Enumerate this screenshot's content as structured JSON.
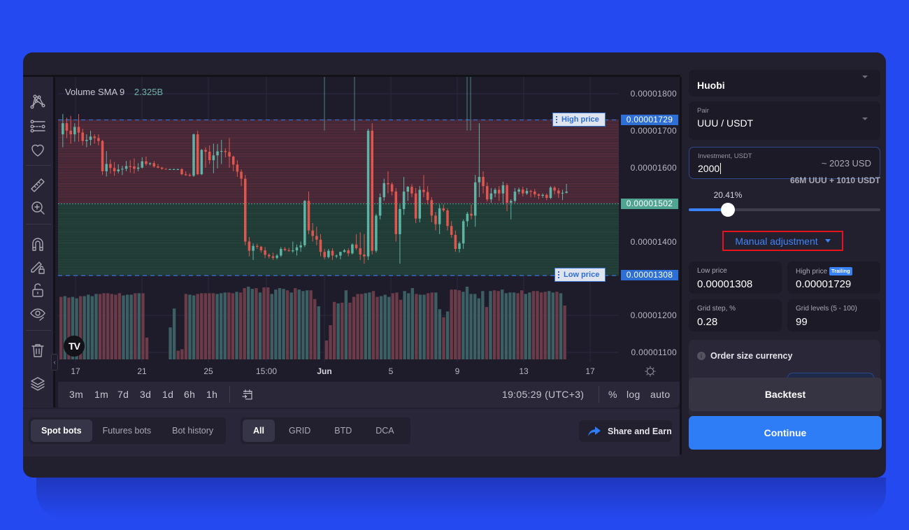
{
  "chart": {
    "volume_legend": {
      "label": "Volume SMA 9",
      "value": "2.325B"
    },
    "price_axis": {
      "labels": [
        "0.00001800",
        "0.00001700",
        "0.00001600",
        "0.00001400",
        "0.00001200",
        "0.00001100"
      ],
      "high_price_tag": "0.00001729",
      "current_price_tag": "0.00001502",
      "low_price_tag": "0.00001308"
    },
    "level_tags": {
      "high": "High price",
      "low": "Low price"
    },
    "time_axis": [
      "17",
      "21",
      "25",
      "15:00",
      "Jun",
      "5",
      "9",
      "13",
      "17"
    ],
    "range_buttons": [
      "3m",
      "1m",
      "7d",
      "3d",
      "1d",
      "6h",
      "1h"
    ],
    "clock": "19:05:29 (UTC+3)",
    "scale_buttons": [
      "%",
      "log",
      "auto"
    ],
    "logo": "TV",
    "colors": {
      "up": "#5fb3a5",
      "down": "#e0564f",
      "high_line": "#3a6fd8",
      "current_tag": "#4fa592",
      "level_tag": "#2e7cf6"
    },
    "candles": [
      [
        1690,
        1745,
        1655,
        1720
      ],
      [
        1720,
        1735,
        1680,
        1700
      ],
      [
        1700,
        1740,
        1665,
        1690
      ],
      [
        1690,
        1720,
        1670,
        1710
      ],
      [
        1710,
        1745,
        1670,
        1695
      ],
      [
        1695,
        1705,
        1660,
        1672
      ],
      [
        1672,
        1690,
        1655,
        1675
      ],
      [
        1675,
        1700,
        1660,
        1684
      ],
      [
        1684,
        1690,
        1665,
        1680
      ],
      [
        1680,
        1690,
        1660,
        1672
      ],
      [
        1672,
        1675,
        1580,
        1590
      ],
      [
        1590,
        1645,
        1576,
        1610
      ],
      [
        1610,
        1622,
        1584,
        1599
      ],
      [
        1599,
        1615,
        1578,
        1590
      ],
      [
        1590,
        1609,
        1585,
        1595
      ],
      [
        1595,
        1605,
        1580,
        1597
      ],
      [
        1597,
        1618,
        1590,
        1604
      ],
      [
        1604,
        1620,
        1586,
        1603
      ],
      [
        1603,
        1625,
        1584,
        1597
      ],
      [
        1597,
        1612,
        1590,
        1600
      ],
      [
        1600,
        1628,
        1598,
        1617
      ],
      [
        1617,
        1630,
        1605,
        1610
      ],
      [
        1610,
        1614,
        1606,
        1612
      ],
      [
        1612,
        1618,
        1600,
        1603
      ],
      [
        1603,
        1610,
        1598,
        1600
      ],
      [
        1600,
        1602,
        1594,
        1597
      ],
      [
        1597,
        1598,
        1595,
        1596
      ],
      [
        1596,
        1597,
        1595,
        1596
      ],
      [
        1596,
        1597,
        1595,
        1596
      ],
      [
        1596,
        1597,
        1595,
        1596
      ],
      [
        1596,
        1598,
        1580,
        1582
      ],
      [
        1582,
        1590,
        1578,
        1580
      ],
      [
        1580,
        1584,
        1576,
        1578
      ],
      [
        1578,
        1692,
        1575,
        1690
      ],
      [
        1690,
        1700,
        1580,
        1582
      ],
      [
        1582,
        1650,
        1580,
        1648
      ],
      [
        1648,
        1655,
        1600,
        1643
      ],
      [
        1643,
        1660,
        1610,
        1620
      ],
      [
        1620,
        1665,
        1585,
        1633
      ],
      [
        1633,
        1664,
        1598,
        1644
      ],
      [
        1644,
        1675,
        1610,
        1645
      ],
      [
        1645,
        1652,
        1628,
        1642
      ],
      [
        1642,
        1680,
        1600,
        1630
      ],
      [
        1630,
        1632,
        1590,
        1608
      ],
      [
        1608,
        1620,
        1575,
        1589
      ],
      [
        1589,
        1595,
        1550,
        1570
      ],
      [
        1570,
        1580,
        1390,
        1400
      ],
      [
        1400,
        1412,
        1360,
        1375
      ],
      [
        1375,
        1395,
        1350,
        1388
      ],
      [
        1388,
        1394,
        1380,
        1386
      ],
      [
        1386,
        1388,
        1370,
        1376
      ],
      [
        1376,
        1385,
        1355,
        1364
      ],
      [
        1364,
        1368,
        1354,
        1360
      ],
      [
        1360,
        1370,
        1350,
        1356
      ],
      [
        1356,
        1366,
        1352,
        1362
      ],
      [
        1362,
        1385,
        1358,
        1380
      ],
      [
        1380,
        1385,
        1374,
        1377
      ],
      [
        1377,
        1383,
        1372,
        1375
      ],
      [
        1375,
        1400,
        1370,
        1376
      ],
      [
        1376,
        1392,
        1362,
        1384
      ],
      [
        1384,
        1400,
        1372,
        1390
      ],
      [
        1390,
        1512,
        1385,
        1510
      ],
      [
        1510,
        1535,
        1420,
        1430
      ],
      [
        1430,
        1450,
        1400,
        1415
      ],
      [
        1415,
        1440,
        1390,
        1405
      ],
      [
        1405,
        1420,
        1360,
        1372
      ],
      [
        1372,
        1380,
        1352,
        1358
      ],
      [
        1358,
        1380,
        1354,
        1375
      ],
      [
        1375,
        1382,
        1350,
        1362
      ],
      [
        1362,
        1365,
        1355,
        1362
      ],
      [
        1362,
        1370,
        1352,
        1372
      ],
      [
        1372,
        1380,
        1370,
        1376
      ],
      [
        1376,
        1382,
        1360,
        1368
      ],
      [
        1368,
        1395,
        1365,
        1392
      ],
      [
        1392,
        1420,
        1378,
        1382
      ],
      [
        1382,
        1425,
        1350,
        1365
      ],
      [
        1365,
        1420,
        1340,
        1360
      ],
      [
        1360,
        1705,
        1350,
        1700
      ],
      [
        1700,
        1720,
        1365,
        1375
      ],
      [
        1375,
        1475,
        1370,
        1470
      ],
      [
        1470,
        1530,
        1460,
        1520
      ],
      [
        1520,
        1570,
        1510,
        1558
      ],
      [
        1558,
        1590,
        1530,
        1555
      ],
      [
        1555,
        1560,
        1525,
        1535
      ],
      [
        1535,
        1545,
        1400,
        1420
      ],
      [
        1420,
        1500,
        1340,
        1488
      ],
      [
        1488,
        1575,
        1472,
        1535
      ],
      [
        1535,
        1550,
        1510,
        1548
      ],
      [
        1548,
        1555,
        1520,
        1530
      ],
      [
        1530,
        1545,
        1450,
        1462
      ],
      [
        1462,
        1550,
        1452,
        1540
      ],
      [
        1540,
        1580,
        1520,
        1534
      ],
      [
        1534,
        1550,
        1500,
        1512
      ],
      [
        1512,
        1520,
        1452,
        1470
      ],
      [
        1470,
        1480,
        1430,
        1447
      ],
      [
        1447,
        1500,
        1420,
        1490
      ],
      [
        1490,
        1500,
        1480,
        1484
      ],
      [
        1484,
        1490,
        1430,
        1442
      ],
      [
        1442,
        1455,
        1410,
        1418
      ],
      [
        1418,
        1430,
        1372,
        1380
      ],
      [
        1380,
        1400,
        1370,
        1395
      ],
      [
        1395,
        1460,
        1380,
        1455
      ],
      [
        1455,
        1480,
        1440,
        1475
      ],
      [
        1475,
        1500,
        1460,
        1470
      ],
      [
        1470,
        1580,
        1440,
        1560
      ],
      [
        1560,
        1720,
        1520,
        1575
      ],
      [
        1575,
        1590,
        1530,
        1550
      ],
      [
        1550,
        1560,
        1508,
        1514
      ],
      [
        1514,
        1545,
        1505,
        1530
      ],
      [
        1530,
        1545,
        1520,
        1540
      ],
      [
        1540,
        1550,
        1510,
        1530
      ],
      [
        1530,
        1562,
        1500,
        1552
      ],
      [
        1552,
        1558,
        1482,
        1505
      ],
      [
        1505,
        1515,
        1460,
        1510
      ],
      [
        1510,
        1545,
        1505,
        1535
      ],
      [
        1535,
        1546,
        1528,
        1541
      ],
      [
        1541,
        1548,
        1522,
        1530
      ],
      [
        1530,
        1545,
        1526,
        1537
      ],
      [
        1537,
        1540,
        1520,
        1535
      ],
      [
        1535,
        1542,
        1520,
        1528
      ],
      [
        1528,
        1530,
        1515,
        1524
      ],
      [
        1524,
        1530,
        1518,
        1526
      ],
      [
        1526,
        1530,
        1512,
        1518
      ],
      [
        1518,
        1550,
        1515,
        1546
      ],
      [
        1546,
        1550,
        1528,
        1538
      ],
      [
        1538,
        1545,
        1518,
        1530
      ],
      [
        1530,
        1540,
        1512,
        1532
      ],
      [
        1532,
        1556,
        1530,
        1535
      ]
    ],
    "volumes": [
      0.86,
      0.87,
      0.85,
      0.86,
      0.84,
      0.87,
      0.87,
      0.89,
      0.87,
      0.9,
      0.9,
      0.91,
      0.91,
      0.9,
      0.89,
      0.91,
      0.88,
      0.89,
      0.89,
      0.91,
      0.91,
      0.91,
      0.3,
      0,
      0,
      0,
      0,
      0,
      0.44,
      0.7,
      0.12,
      0.14,
      0.9,
      0.89,
      0.88,
      0.9,
      0.91,
      0.91,
      0.91,
      0.91,
      0.9,
      0.91,
      0.92,
      0.92,
      0.91,
      0.93,
      0.92,
      0.98,
      1.0,
      0.97,
      0.98,
      0.92,
      0.99,
      0.99,
      0.9,
      0.96,
      0.98,
      0.97,
      0.95,
      0.92,
      0.98,
      0.96,
      0.94,
      0.95,
      0.95,
      0.83,
      0.73,
      0.0,
      0.26,
      0.47,
      0.79,
      0.77,
      0.78,
      0.95,
      0.78,
      0.86,
      0.9,
      0.9,
      0.91,
      0.92,
      0.94,
      0.86,
      0.87,
      0.89,
      0.86,
      0.91,
      0.92,
      0.82,
      0.94,
      0.91,
      0.98,
      0.9,
      0.89,
      0.89,
      0.91,
      0.92,
      0.92,
      0.69,
      0.58,
      0.66,
      0.96,
      0.96,
      0.95,
      0.93,
      1.0,
      0.9,
      0.9,
      0.84,
      0.94,
      0.72,
      0.94,
      0.95,
      0.94,
      0.96,
      0.91,
      0.92,
      0.92,
      0.91,
      0.95,
      0.9,
      0.92,
      0.94,
      0.94,
      0.92,
      0.93,
      0.94,
      0.92,
      0.93,
      0.91,
      0.74
    ]
  },
  "toolbar": {
    "tools": [
      "anchor-tool",
      "pattern-tool",
      "fib-tool",
      "favorites-tool",
      "measure-tool",
      "zoom-in-tool",
      "magnet-tool",
      "lock-drawing-tool",
      "lock-tool",
      "hide-tool",
      "delete-tool",
      "layers-tool"
    ]
  },
  "lower": {
    "bot_tabs": [
      "Spot bots",
      "Futures bots",
      "Bot history"
    ],
    "type_tabs": [
      "All",
      "GRID",
      "BTD",
      "DCA"
    ],
    "share_label": "Share and Earn"
  },
  "right": {
    "exchange": {
      "value": "Huobi"
    },
    "pair": {
      "label": "Pair",
      "value": "UUU / USDT"
    },
    "investment": {
      "label": "Investment, USDT",
      "value": "2000",
      "usd": "~ 2023 USD"
    },
    "split": "66M UUU + 1010 USDT",
    "slider": {
      "value": 20.41,
      "label": "20.41%"
    },
    "manual_adjustment": "Manual adjustment",
    "low_price": {
      "label": "Low price",
      "value": "0.00001308"
    },
    "high_price": {
      "label": "High price",
      "badge": "Trailing",
      "value": "0.00001729"
    },
    "grid_step": {
      "label": "Grid step, %",
      "value": "0.28"
    },
    "grid_levels": {
      "label": "Grid levels (5 - 100)",
      "value": "99"
    },
    "order_size": {
      "label": "Order size currency",
      "info": "i"
    },
    "backtest": "Backtest",
    "continue": "Continue"
  }
}
